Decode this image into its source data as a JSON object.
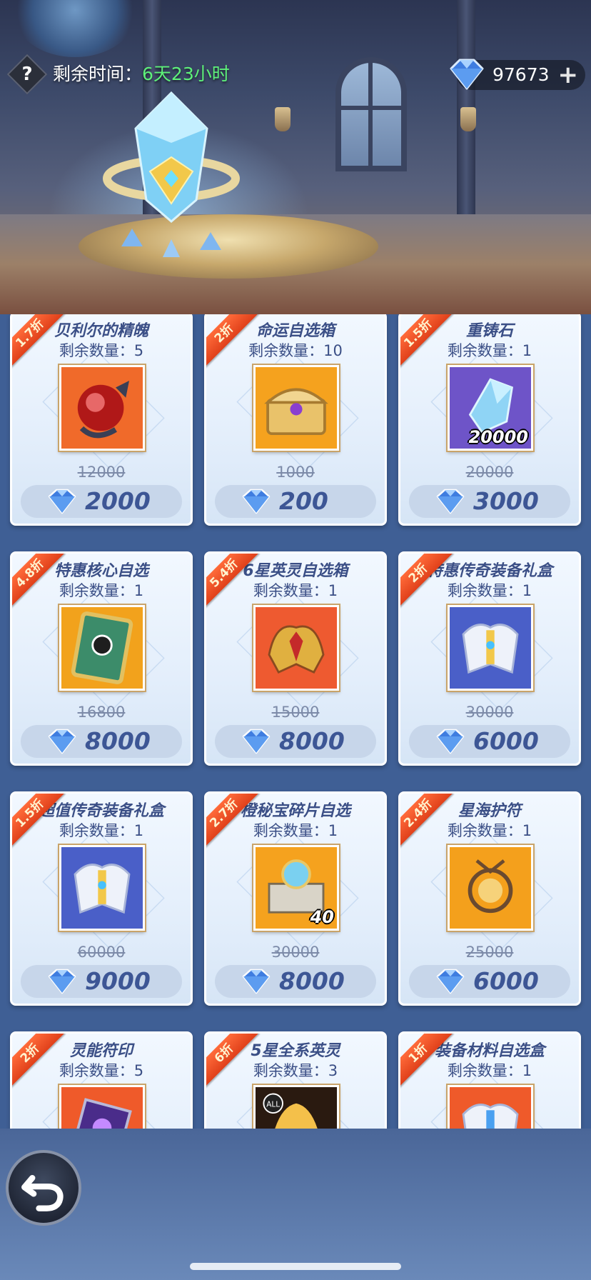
{
  "header": {
    "help_label": "?",
    "timer_label": "剩余时间：",
    "timer_value": "6天23小时",
    "currency_amount": "97673",
    "plus_label": "+"
  },
  "colors": {
    "accent_green": "#5ef07a",
    "price_blue": "#3d5695",
    "ribbon_orange": "#e0401a",
    "gem_blue": "#3f7de0"
  },
  "items": [
    {
      "discount": "1.7折",
      "name": "贝利尔的精魄",
      "stock": "剩余数量：5",
      "original_price": "12000",
      "price": "2000",
      "icon": "red-orb-icon",
      "qty": ""
    },
    {
      "discount": "2折",
      "name": "命运自选箱",
      "stock": "剩余数量：10",
      "original_price": "1000",
      "price": "200",
      "icon": "treasure-chest-icon",
      "qty": ""
    },
    {
      "discount": "1.5折",
      "name": "重铸石",
      "stock": "剩余数量：1",
      "original_price": "20000",
      "price": "3000",
      "icon": "reforge-stone-icon",
      "qty": "20000"
    },
    {
      "discount": "4.8折",
      "name": "特惠核心自选",
      "stock": "剩余数量：1",
      "original_price": "16800",
      "price": "8000",
      "icon": "core-card-icon",
      "qty": ""
    },
    {
      "discount": "5.4折",
      "name": "6星英灵自选箱",
      "stock": "剩余数量：1",
      "original_price": "15000",
      "price": "8000",
      "icon": "hero-helmet-icon",
      "qty": ""
    },
    {
      "discount": "2折",
      "name": "特惠传奇装备礼盒",
      "stock": "剩余数量：1",
      "original_price": "30000",
      "price": "6000",
      "icon": "legend-armor-icon",
      "qty": ""
    },
    {
      "discount": "1.5折",
      "name": "超值传奇装备礼盒",
      "stock": "剩余数量：1",
      "original_price": "60000",
      "price": "9000",
      "icon": "legend-armor-icon",
      "qty": ""
    },
    {
      "discount": "2.7折",
      "name": "橙秘宝碎片自选",
      "stock": "剩余数量：1",
      "original_price": "30000",
      "price": "8000",
      "icon": "relic-box-icon",
      "qty": "40"
    },
    {
      "discount": "2.4折",
      "name": "星海护符",
      "stock": "剩余数量：1",
      "original_price": "25000",
      "price": "6000",
      "icon": "star-amulet-icon",
      "qty": ""
    },
    {
      "discount": "2折",
      "name": "灵能符印",
      "stock": "剩余数量：5",
      "original_price": "",
      "price": "",
      "icon": "psionic-seal-icon",
      "qty": ""
    },
    {
      "discount": "6折",
      "name": "5星全系英灵",
      "stock": "剩余数量：3",
      "original_price": "",
      "price": "",
      "icon": "all-hero-icon",
      "qty": ""
    },
    {
      "discount": "1折",
      "name": "装备材料自选盒",
      "stock": "剩余数量：1",
      "original_price": "",
      "price": "",
      "icon": "equip-material-icon",
      "qty": ""
    }
  ],
  "footer": {
    "back_icon": "back-arrow-icon"
  }
}
